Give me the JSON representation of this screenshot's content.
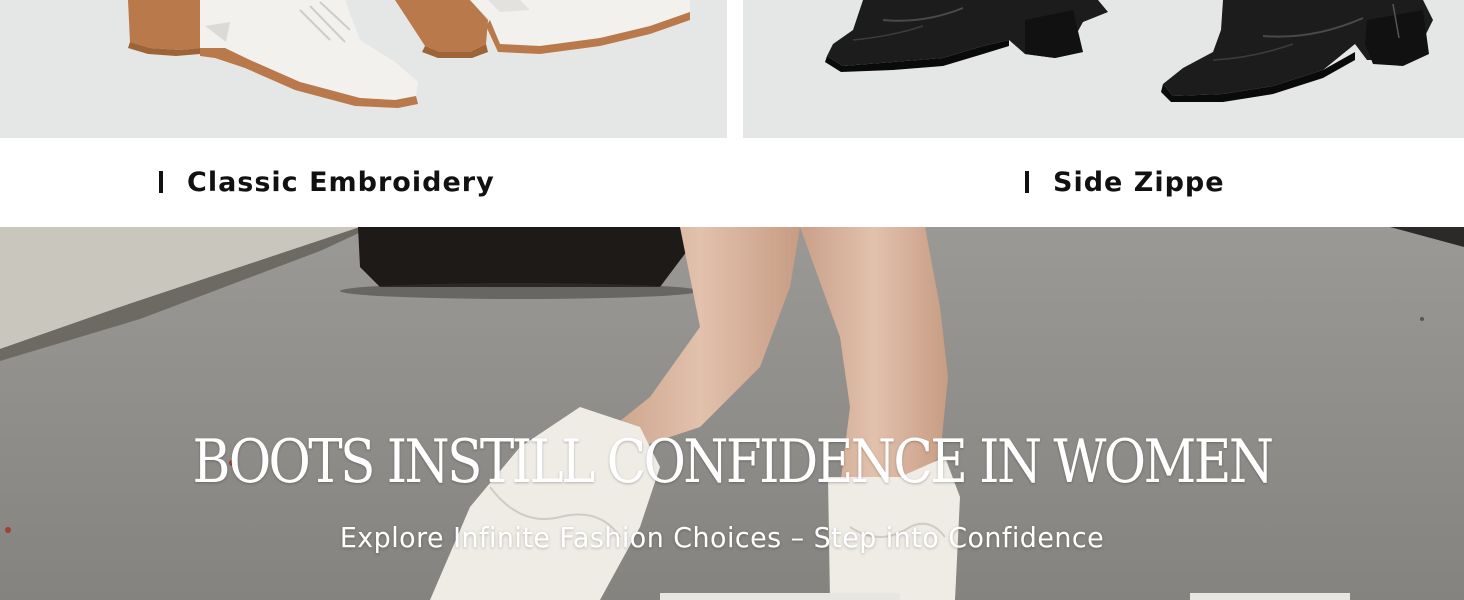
{
  "products": [
    {
      "caption": "Classic Embroidery",
      "boot_color": "white"
    },
    {
      "caption": "Side Zippe",
      "boot_color": "black"
    }
  ],
  "hero": {
    "title": "BOOTS INSTILL CONFIDENCE IN WOMEN",
    "subtitle": "Explore Infinite Fashion Choices – Step into Confidence"
  },
  "colors": {
    "panel_bg": "#e5e7e6",
    "caption_text": "#111111",
    "hero_text": "#ffffff",
    "boot_white": "#f2f1ee",
    "boot_black": "#1c1c1c",
    "heel_wood": "#b9794a"
  }
}
